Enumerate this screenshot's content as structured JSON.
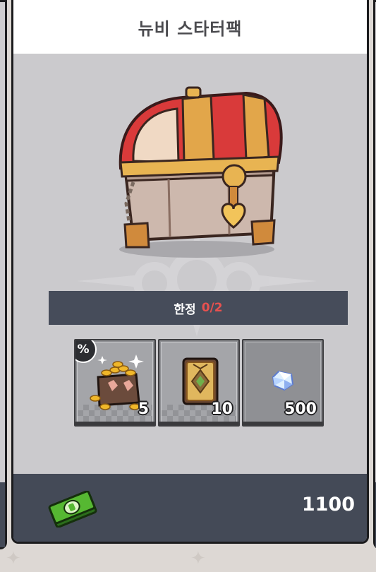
{
  "card": {
    "title": "뉴비 스타터팩",
    "limit": {
      "label": "한정",
      "value": "0/2",
      "value_color": "#e8514f"
    },
    "items": [
      {
        "icon": "gold-coin-chest-icon",
        "quantity": "5",
        "has_discount_badge": true
      },
      {
        "icon": "card-pack-icon",
        "quantity": "10",
        "has_discount_badge": false
      },
      {
        "icon": "crystal-gem-icon",
        "quantity": "500",
        "has_discount_badge": false
      }
    ],
    "discount_badge": "%",
    "price": {
      "currency_icon": "cash-bill-icon",
      "amount": "1100"
    }
  },
  "colors": {
    "footer": "#444a57",
    "limit_bar": "#464c5a",
    "accent_red": "#e8514f"
  }
}
